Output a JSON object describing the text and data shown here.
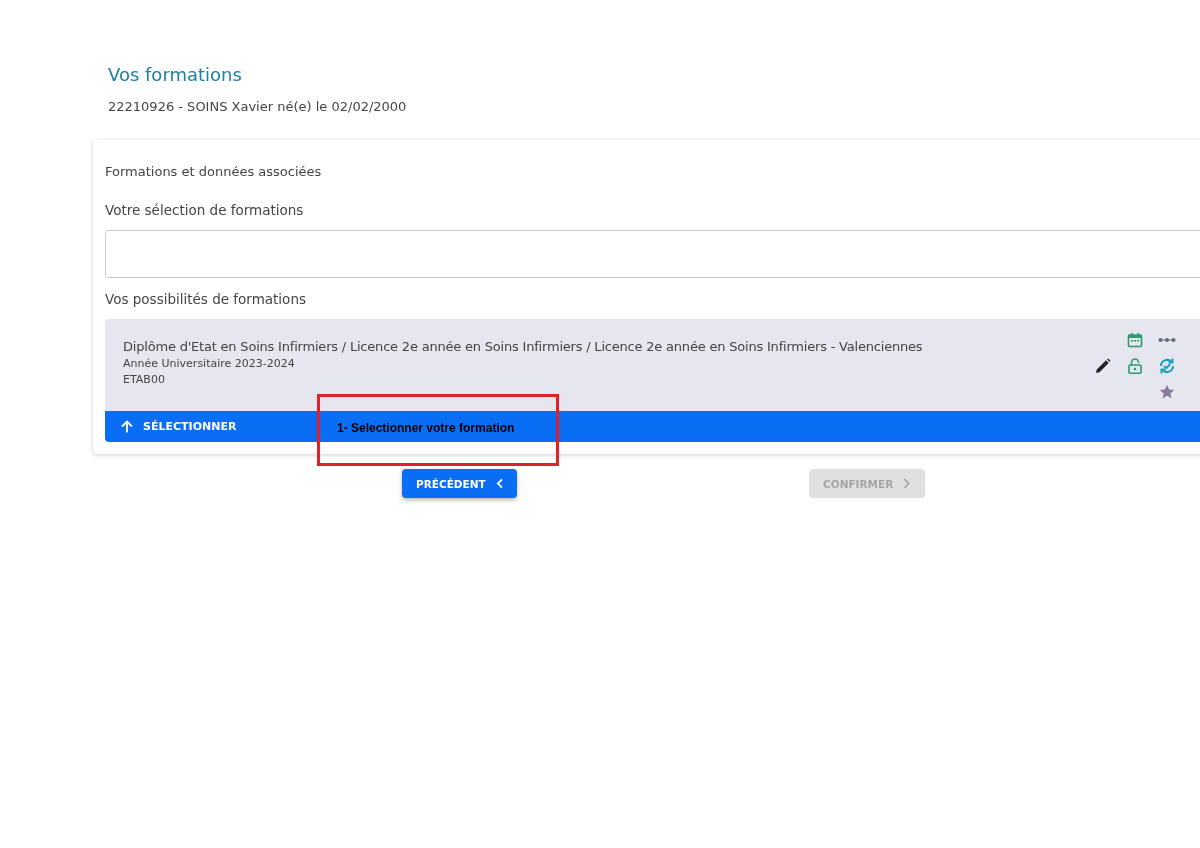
{
  "page": {
    "title": "Vos formations",
    "student": "22210926 - SOINS Xavier né(e) le 02/02/2000"
  },
  "card": {
    "heading": "Formations et données associées",
    "selection_label": "Votre sélection de formations",
    "possibilities_label": "Vos possibilités de formations",
    "formations": [
      {
        "title": "Diplôme d'Etat en Soins Infirmiers / Licence 2e année en Soins Infirmiers / Licence 2e année en Soins Infirmiers - Valenciennes",
        "year": "Année Universitaire 2023-2024",
        "code": "ETAB00",
        "select_label": "SÉLECTIONNER"
      }
    ]
  },
  "annotation": {
    "text": "1- Selectionner votre formation"
  },
  "buttons": [
    {
      "label": "PRÉCÉDENT",
      "kind": "back",
      "disabled": false
    },
    {
      "label": "CONFIRMER",
      "kind": "next",
      "disabled": true
    }
  ]
}
